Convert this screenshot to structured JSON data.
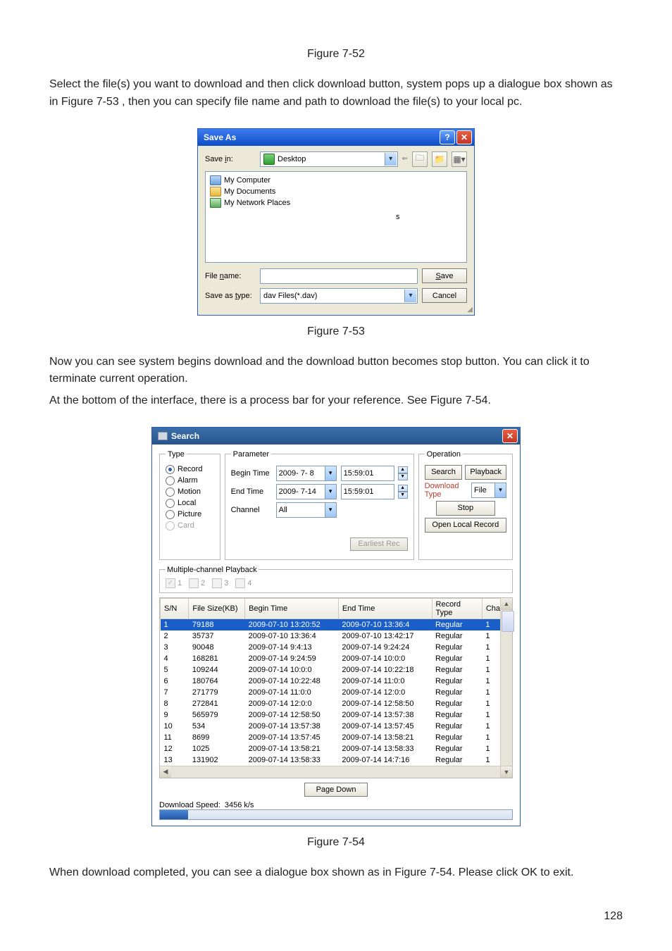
{
  "captions": {
    "f52": "Figure 7-52",
    "f53": "Figure 7-53",
    "f54": "Figure 7-54"
  },
  "paras": {
    "p1": "Select the file(s) you want to download and then click download button, system pops up a dialogue box shown as in Figure 7-53 , then you can specify file name and path to download the file(s) to your local pc.",
    "p2": "Now you can see system begins download and the download button becomes stop button. You can click it to terminate current operation.",
    "p3": "At the bottom of the interface, there is a process bar for your reference. See Figure 7-54.",
    "p4": "When download completed, you can see a dialogue box shown as in Figure 7-54. Please click OK to exit."
  },
  "page_number": "128",
  "saveas": {
    "title": "Save As",
    "savein_label_pre": "Save ",
    "savein_label_u": "i",
    "savein_label_post": "n:",
    "savein_value": "Desktop",
    "list": [
      "My Computer",
      "My Documents",
      "My Network Places"
    ],
    "stray_char": "s",
    "filename_label_pre": "File ",
    "filename_label_u": "n",
    "filename_label_post": "ame:",
    "filename_value": "",
    "saveastype_label_pre": "Save as ",
    "saveastype_label_u": "t",
    "saveastype_label_post": "ype:",
    "saveastype_value": "dav Files(*.dav)",
    "save_btn_u": "S",
    "save_btn_rest": "ave",
    "cancel_btn": "Cancel"
  },
  "search": {
    "title": "Search",
    "type_legend": "Type",
    "type_options": [
      "Record",
      "Alarm",
      "Motion",
      "Local",
      "Picture",
      "Card"
    ],
    "param_legend": "Parameter",
    "begin_label": "Begin Time",
    "begin_date": "2009- 7- 8",
    "begin_time": "15:59:01",
    "end_label": "End Time",
    "end_date": "2009- 7-14",
    "end_time": "15:59:01",
    "channel_label": "Channel",
    "channel_value": "All",
    "earliest_btn": "Earliest Rec",
    "op_legend": "Operation",
    "search_btn": "Search",
    "playback_btn": "Playback",
    "dltype_label": "Download Type",
    "dltype_value": "File",
    "stop_btn": "Stop",
    "openlocal_btn": "Open Local Record",
    "mc_legend": "Multiple-channel Playback",
    "mc_labels": [
      "1",
      "2",
      "3",
      "4"
    ],
    "cols": [
      "S/N",
      "File Size(KB)",
      "Begin Time",
      "End Time",
      "Record Type",
      "Chan"
    ],
    "rows": [
      {
        "sn": "1",
        "fs": "79188",
        "bt": "2009-07-10 13:20:52",
        "et": "2009-07-10 13:36:4",
        "rt": "Regular",
        "ch": "1",
        "sel": true
      },
      {
        "sn": "2",
        "fs": "35737",
        "bt": "2009-07-10 13:36:4",
        "et": "2009-07-10 13:42:17",
        "rt": "Regular",
        "ch": "1"
      },
      {
        "sn": "3",
        "fs": "90048",
        "bt": "2009-07-14 9:4:13",
        "et": "2009-07-14 9:24:24",
        "rt": "Regular",
        "ch": "1"
      },
      {
        "sn": "4",
        "fs": "168281",
        "bt": "2009-07-14 9:24:59",
        "et": "2009-07-14 10:0:0",
        "rt": "Regular",
        "ch": "1"
      },
      {
        "sn": "5",
        "fs": "109244",
        "bt": "2009-07-14 10:0:0",
        "et": "2009-07-14 10:22:18",
        "rt": "Regular",
        "ch": "1"
      },
      {
        "sn": "6",
        "fs": "180764",
        "bt": "2009-07-14 10:22:48",
        "et": "2009-07-14 11:0:0",
        "rt": "Regular",
        "ch": "1"
      },
      {
        "sn": "7",
        "fs": "271779",
        "bt": "2009-07-14 11:0:0",
        "et": "2009-07-14 12:0:0",
        "rt": "Regular",
        "ch": "1"
      },
      {
        "sn": "8",
        "fs": "272841",
        "bt": "2009-07-14 12:0:0",
        "et": "2009-07-14 12:58:50",
        "rt": "Regular",
        "ch": "1"
      },
      {
        "sn": "9",
        "fs": "565979",
        "bt": "2009-07-14 12:58:50",
        "et": "2009-07-14 13:57:38",
        "rt": "Regular",
        "ch": "1"
      },
      {
        "sn": "10",
        "fs": "534",
        "bt": "2009-07-14 13:57:38",
        "et": "2009-07-14 13:57:45",
        "rt": "Regular",
        "ch": "1"
      },
      {
        "sn": "11",
        "fs": "8699",
        "bt": "2009-07-14 13:57:45",
        "et": "2009-07-14 13:58:21",
        "rt": "Regular",
        "ch": "1"
      },
      {
        "sn": "12",
        "fs": "1025",
        "bt": "2009-07-14 13:58:21",
        "et": "2009-07-14 13:58:33",
        "rt": "Regular",
        "ch": "1"
      },
      {
        "sn": "13",
        "fs": "131902",
        "bt": "2009-07-14 13:58:33",
        "et": "2009-07-14 14:7:16",
        "rt": "Regular",
        "ch": "1"
      }
    ],
    "pagedown_btn": "Page Down",
    "dlspeed_label": "Download Speed:",
    "dlspeed_value": "3456 k/s"
  }
}
